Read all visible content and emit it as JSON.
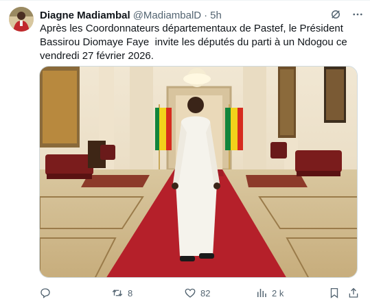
{
  "tweet": {
    "author_name": "Diagne Madiambal",
    "author_handle": "@MadiambalD",
    "separator": "·",
    "time": "5h",
    "text": "Après les Coordonnateurs départementaux de Pastef, le Président Bassirou Diomaye Faye  invite les députés du parti à un Ndogou ce vendredi 27 février 2026.",
    "icons": {
      "grok": "grok-icon",
      "more": "more-icon"
    }
  },
  "actions": {
    "reply_count": "",
    "repost_count": "8",
    "like_count": "82",
    "views_count": "2 k"
  },
  "colors": {
    "text": "#0f1419",
    "secondary": "#536471",
    "border": "#cfd9de",
    "carpet": "#b5202a"
  }
}
